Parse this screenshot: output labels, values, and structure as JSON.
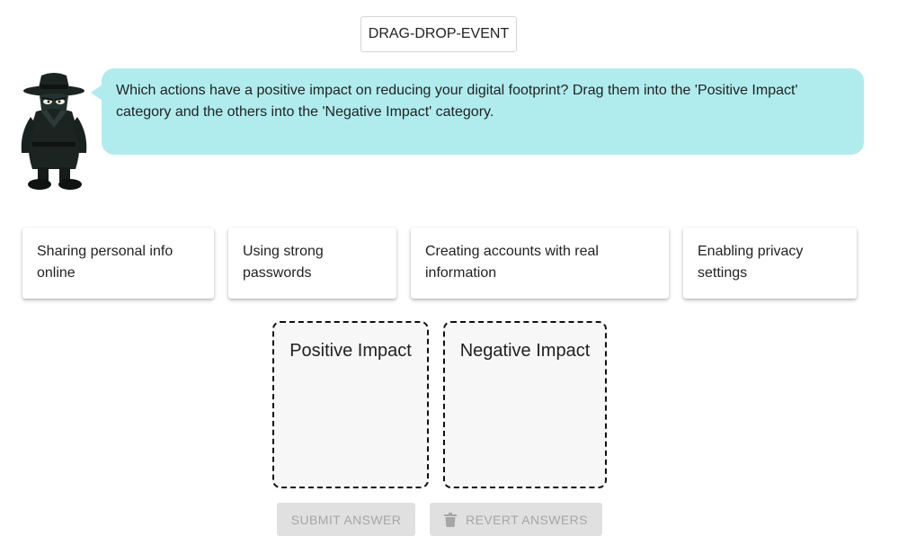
{
  "header": {
    "event_tag": "DRAG-DROP-EVENT"
  },
  "instruction": {
    "text": "Which actions have a positive impact on reducing your digital footprint? Drag them into the 'Positive Impact' category and the others into the 'Negative Impact' category."
  },
  "cards": [
    {
      "label": "Sharing personal info online"
    },
    {
      "label": "Using strong passwords"
    },
    {
      "label": "Creating accounts with real information"
    },
    {
      "label": "Enabling privacy settings"
    }
  ],
  "drop_zones": [
    {
      "label": "Positive Impact"
    },
    {
      "label": "Negative Impact"
    }
  ],
  "buttons": {
    "submit": "SUBMIT ANSWER",
    "revert": "REVERT ANSWERS"
  },
  "colors": {
    "bubble": "#b0ecee",
    "zone_background": "#f7f7f7",
    "disabled_button": "#e0e0e0",
    "disabled_text": "#a6a6a6"
  }
}
